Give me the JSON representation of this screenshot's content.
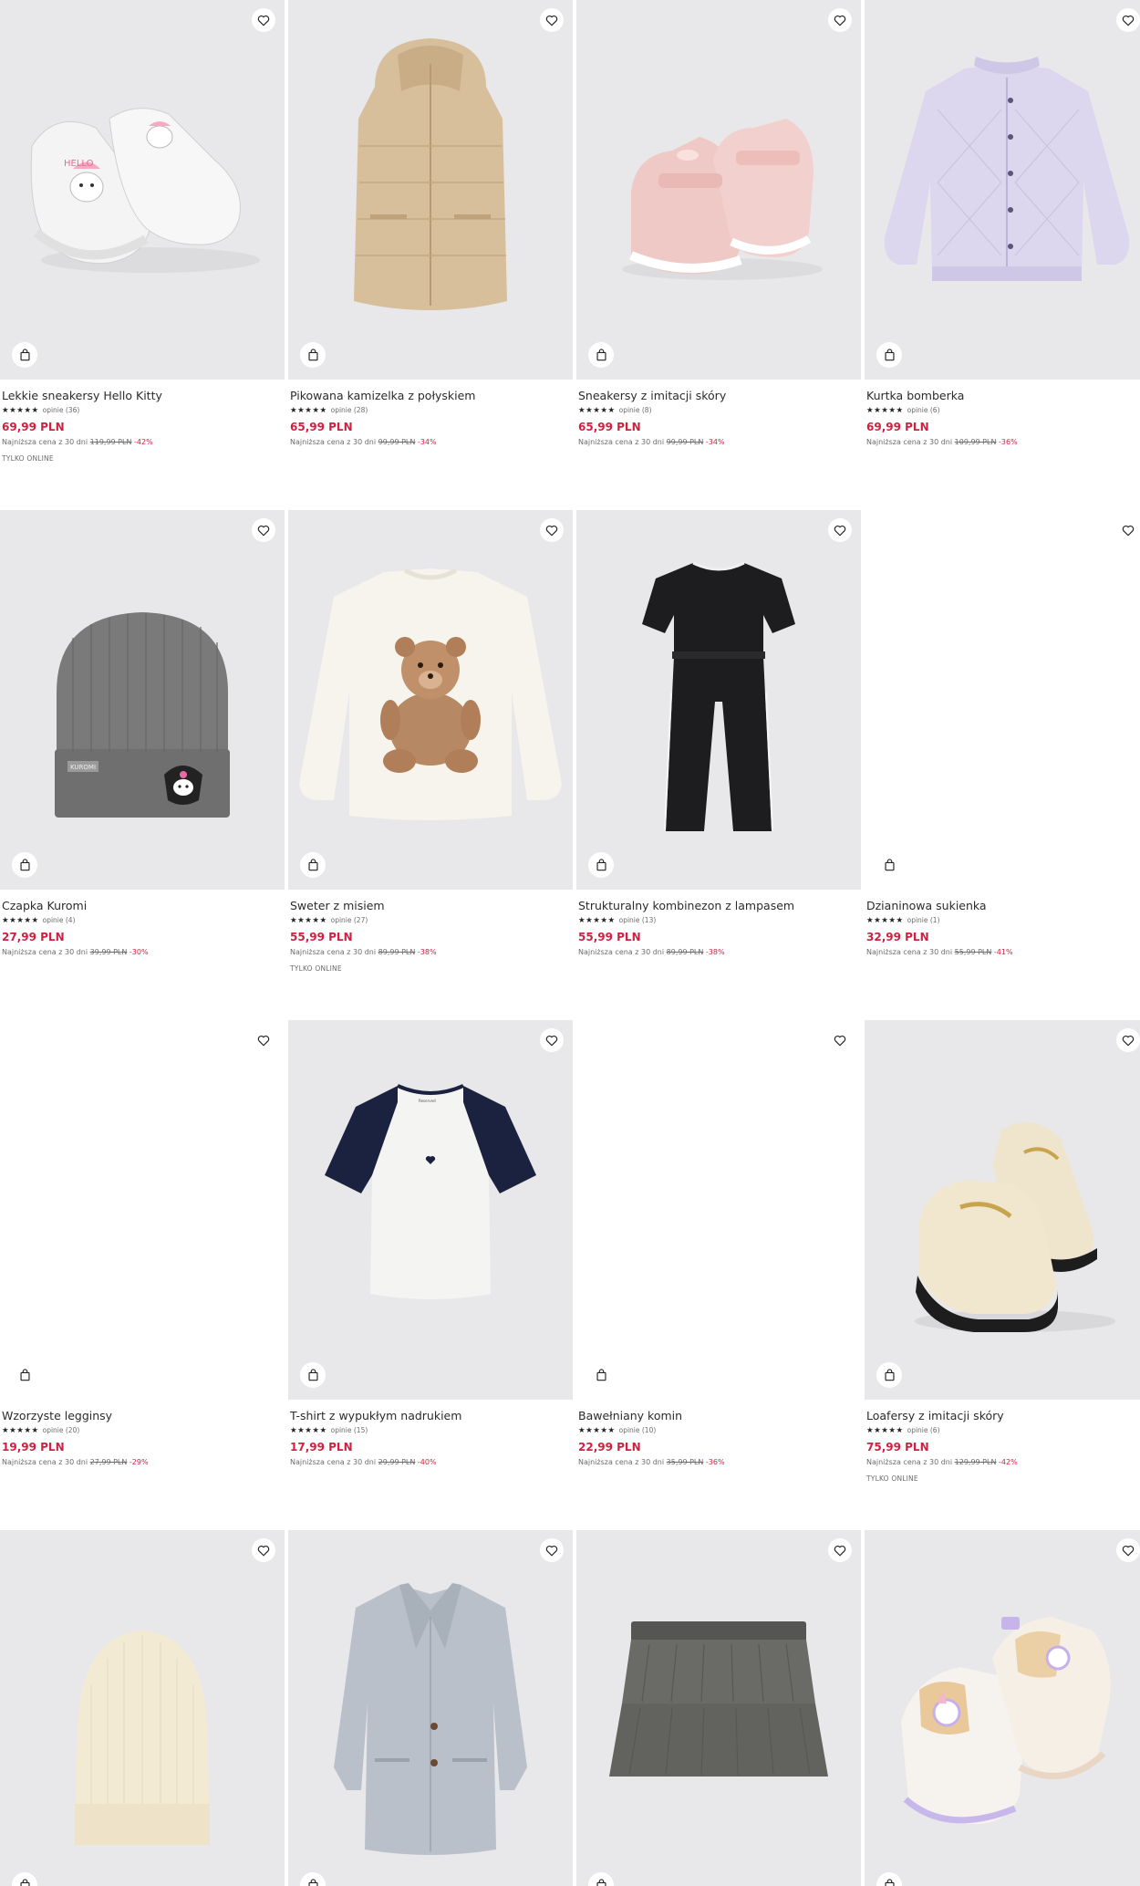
{
  "icons": {
    "wishlist": "heart-outline-icon",
    "cart": "shopping-bag-icon"
  },
  "colors": {
    "price": "#cf2140",
    "tile_bg": "#e8e8ea",
    "text": "#2b2b2b"
  },
  "products": [
    {
      "id": "p1",
      "name": "Lekkie sneakersy Hello Kitty",
      "stars": "★★★★★",
      "reviews": "opinie (36)",
      "price": "69,99 PLN",
      "lowest_label": "Najniższa cena z 30 dni",
      "old_price": "119,99 PLN",
      "discount": "-42%",
      "badge": "TYLKO ONLINE",
      "image": "sneakers-hello-kitty"
    },
    {
      "id": "p2",
      "name": "Pikowana kamizelka z połyskiem",
      "stars": "★★★★★",
      "reviews": "opinie (28)",
      "price": "65,99 PLN",
      "lowest_label": "Najniższa cena z 30 dni",
      "old_price": "99,99 PLN",
      "discount": "-34%",
      "badge": "",
      "image": "puffer-vest"
    },
    {
      "id": "p3",
      "name": "Sneakersy z imitacji skóry",
      "stars": "★★★★★",
      "reviews": "opinie (8)",
      "price": "65,99 PLN",
      "lowest_label": "Najniższa cena z 30 dni",
      "old_price": "99,99 PLN",
      "discount": "-34%",
      "badge": "",
      "image": "pink-sneakers"
    },
    {
      "id": "p4",
      "name": "Kurtka bomberka",
      "stars": "★★★★★",
      "reviews": "opinie (6)",
      "price": "69,99 PLN",
      "lowest_label": "Najniższa cena z 30 dni",
      "old_price": "109,99 PLN",
      "discount": "-36%",
      "badge": "",
      "image": "bomber-jacket"
    },
    {
      "id": "p5",
      "name": "Czapka Kuromi",
      "stars": "★★★★★",
      "reviews": "opinie (4)",
      "price": "27,99 PLN",
      "lowest_label": "Najniższa cena z 30 dni",
      "old_price": "39,99 PLN",
      "discount": "-30%",
      "badge": "",
      "image": "beanie-kuromi"
    },
    {
      "id": "p6",
      "name": "Sweter z misiem",
      "stars": "★★★★★",
      "reviews": "opinie (27)",
      "price": "55,99 PLN",
      "lowest_label": "Najniższa cena z 30 dni",
      "old_price": "89,99 PLN",
      "discount": "-38%",
      "badge": "TYLKO ONLINE",
      "image": "teddy-sweater"
    },
    {
      "id": "p7",
      "name": "Strukturalny kombinezon z lampasem",
      "stars": "★★★★★",
      "reviews": "opinie (13)",
      "price": "55,99 PLN",
      "lowest_label": "Najniższa cena z 30 dni",
      "old_price": "89,99 PLN",
      "discount": "-38%",
      "badge": "",
      "image": "black-jumpsuit"
    },
    {
      "id": "p8",
      "name": "Dzianinowa sukienka",
      "stars": "★★★★★",
      "reviews": "opinie (1)",
      "price": "32,99 PLN",
      "lowest_label": "Najniższa cena z 30 dni",
      "old_price": "55,99 PLN",
      "discount": "-41%",
      "badge": "",
      "image": ""
    },
    {
      "id": "p9",
      "name": "Wzorzyste legginsy",
      "stars": "★★★★★",
      "reviews": "opinie (20)",
      "price": "19,99 PLN",
      "lowest_label": "Najniższa cena z 30 dni",
      "old_price": "27,99 PLN",
      "discount": "-29%",
      "badge": "",
      "image": ""
    },
    {
      "id": "p10",
      "name": "T-shirt z wypukłym nadrukiem",
      "stars": "★★★★★",
      "reviews": "opinie (15)",
      "price": "17,99 PLN",
      "lowest_label": "Najniższa cena z 30 dni",
      "old_price": "29,99 PLN",
      "discount": "-40%",
      "badge": "",
      "image": "raglan-tshirt"
    },
    {
      "id": "p11",
      "name": "Bawełniany komin",
      "stars": "★★★★★",
      "reviews": "opinie (10)",
      "price": "22,99 PLN",
      "lowest_label": "Najniższa cena z 30 dni",
      "old_price": "35,99 PLN",
      "discount": "-36%",
      "badge": "",
      "image": ""
    },
    {
      "id": "p12",
      "name": "Loafersy z imitacji skóry",
      "stars": "★★★★★",
      "reviews": "opinie (6)",
      "price": "75,99 PLN",
      "lowest_label": "Najniższa cena z 30 dni",
      "old_price": "129,99 PLN",
      "discount": "-42%",
      "badge": "TYLKO ONLINE",
      "image": "cream-loafers"
    },
    {
      "id": "p13",
      "name": "",
      "image": "cream-beanie"
    },
    {
      "id": "p14",
      "name": "",
      "image": "grey-coat"
    },
    {
      "id": "p15",
      "name": "",
      "image": "grey-skirt"
    },
    {
      "id": "p16",
      "name": "",
      "image": "unicorn-sneakers"
    }
  ]
}
